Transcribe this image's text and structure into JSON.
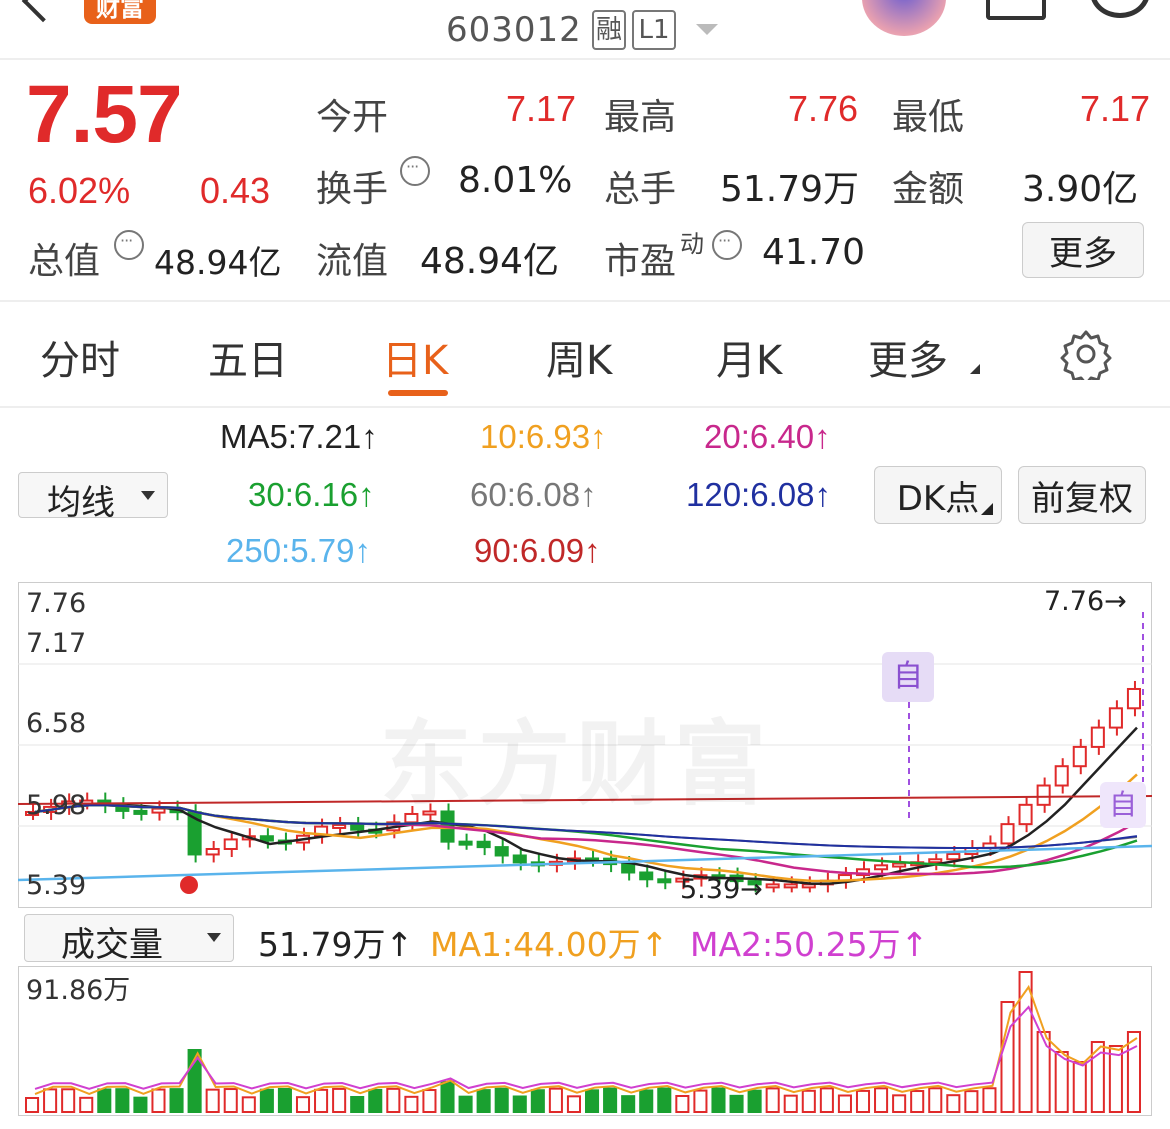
{
  "header": {
    "badge": "财富",
    "code": "603012",
    "tag_rong": "融",
    "tag_level": "L1"
  },
  "quote": {
    "price": "7.57",
    "change_pct": "6.02%",
    "change": "0.43",
    "total_value_label": "总值",
    "total_value": "48.94亿",
    "open_label": "今开",
    "open": "7.17",
    "high_label": "最高",
    "high": "7.76",
    "low_label": "最低",
    "low": "7.17",
    "turnover_label": "换手",
    "turnover": "8.01%",
    "volume_label": "总手",
    "volume": "51.79万",
    "amount_label": "金额",
    "amount": "3.90亿",
    "float_label": "流值",
    "float_value": "48.94亿",
    "pe_label": "市盈",
    "pe_sup": "动",
    "pe": "41.70",
    "more_label": "更多"
  },
  "tabs": [
    "分时",
    "五日",
    "日K",
    "周K",
    "月K",
    "更多"
  ],
  "active_tab": "日K",
  "ma_panel": {
    "select_label": "均线",
    "dk_label": "DK点",
    "fq_label": "前复权",
    "items": [
      {
        "text": "MA5:7.21↑",
        "color": "#222222"
      },
      {
        "text": "10:6.93↑",
        "color": "#f0a020"
      },
      {
        "text": "20:6.40↑",
        "color": "#c8288c"
      },
      {
        "text": "30:6.16↑",
        "color": "#1aa030"
      },
      {
        "text": "60:6.08↑",
        "color": "#777777"
      },
      {
        "text": "120:6.08↑",
        "color": "#2030a0"
      },
      {
        "text": "250:5.79↑",
        "color": "#5ab4ec"
      },
      {
        "text": "90:6.09↑",
        "color": "#c02828"
      }
    ]
  },
  "kline": {
    "y_labels": [
      "7.76",
      "7.17",
      "6.58",
      "5.98",
      "5.39"
    ],
    "max_marker": "7.76→",
    "min_marker": "5.39→",
    "self_label": "自",
    "watermark": "东方财富"
  },
  "volume_panel": {
    "select_label": "成交量",
    "vol": "51.79万↑",
    "ma1": "MA1:44.00万↑",
    "ma2": "MA2:50.25万↑",
    "ma1_color": "#f0a020",
    "ma2_color": "#d040d0",
    "max_label": "91.86万"
  },
  "colors": {
    "up": "#e02a2a",
    "down": "#1aa030",
    "accent": "#e8611a"
  }
}
